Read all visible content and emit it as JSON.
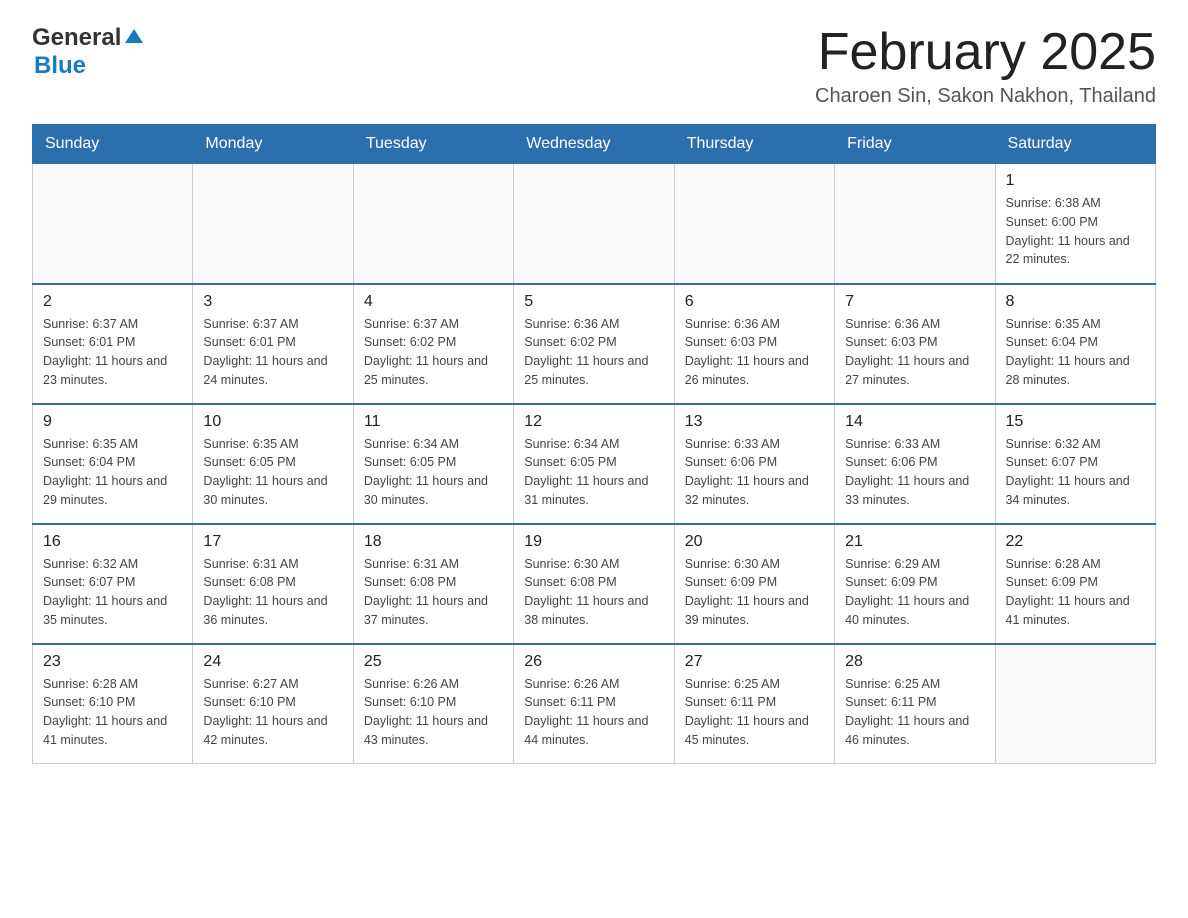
{
  "header": {
    "logo_text_general": "General",
    "logo_text_blue": "Blue",
    "title": "February 2025",
    "subtitle": "Charoen Sin, Sakon Nakhon, Thailand"
  },
  "days_of_week": [
    "Sunday",
    "Monday",
    "Tuesday",
    "Wednesday",
    "Thursday",
    "Friday",
    "Saturday"
  ],
  "weeks": [
    {
      "days": [
        {
          "number": "",
          "info": ""
        },
        {
          "number": "",
          "info": ""
        },
        {
          "number": "",
          "info": ""
        },
        {
          "number": "",
          "info": ""
        },
        {
          "number": "",
          "info": ""
        },
        {
          "number": "",
          "info": ""
        },
        {
          "number": "1",
          "info": "Sunrise: 6:38 AM\nSunset: 6:00 PM\nDaylight: 11 hours and 22 minutes."
        }
      ]
    },
    {
      "days": [
        {
          "number": "2",
          "info": "Sunrise: 6:37 AM\nSunset: 6:01 PM\nDaylight: 11 hours and 23 minutes."
        },
        {
          "number": "3",
          "info": "Sunrise: 6:37 AM\nSunset: 6:01 PM\nDaylight: 11 hours and 24 minutes."
        },
        {
          "number": "4",
          "info": "Sunrise: 6:37 AM\nSunset: 6:02 PM\nDaylight: 11 hours and 25 minutes."
        },
        {
          "number": "5",
          "info": "Sunrise: 6:36 AM\nSunset: 6:02 PM\nDaylight: 11 hours and 25 minutes."
        },
        {
          "number": "6",
          "info": "Sunrise: 6:36 AM\nSunset: 6:03 PM\nDaylight: 11 hours and 26 minutes."
        },
        {
          "number": "7",
          "info": "Sunrise: 6:36 AM\nSunset: 6:03 PM\nDaylight: 11 hours and 27 minutes."
        },
        {
          "number": "8",
          "info": "Sunrise: 6:35 AM\nSunset: 6:04 PM\nDaylight: 11 hours and 28 minutes."
        }
      ]
    },
    {
      "days": [
        {
          "number": "9",
          "info": "Sunrise: 6:35 AM\nSunset: 6:04 PM\nDaylight: 11 hours and 29 minutes."
        },
        {
          "number": "10",
          "info": "Sunrise: 6:35 AM\nSunset: 6:05 PM\nDaylight: 11 hours and 30 minutes."
        },
        {
          "number": "11",
          "info": "Sunrise: 6:34 AM\nSunset: 6:05 PM\nDaylight: 11 hours and 30 minutes."
        },
        {
          "number": "12",
          "info": "Sunrise: 6:34 AM\nSunset: 6:05 PM\nDaylight: 11 hours and 31 minutes."
        },
        {
          "number": "13",
          "info": "Sunrise: 6:33 AM\nSunset: 6:06 PM\nDaylight: 11 hours and 32 minutes."
        },
        {
          "number": "14",
          "info": "Sunrise: 6:33 AM\nSunset: 6:06 PM\nDaylight: 11 hours and 33 minutes."
        },
        {
          "number": "15",
          "info": "Sunrise: 6:32 AM\nSunset: 6:07 PM\nDaylight: 11 hours and 34 minutes."
        }
      ]
    },
    {
      "days": [
        {
          "number": "16",
          "info": "Sunrise: 6:32 AM\nSunset: 6:07 PM\nDaylight: 11 hours and 35 minutes."
        },
        {
          "number": "17",
          "info": "Sunrise: 6:31 AM\nSunset: 6:08 PM\nDaylight: 11 hours and 36 minutes."
        },
        {
          "number": "18",
          "info": "Sunrise: 6:31 AM\nSunset: 6:08 PM\nDaylight: 11 hours and 37 minutes."
        },
        {
          "number": "19",
          "info": "Sunrise: 6:30 AM\nSunset: 6:08 PM\nDaylight: 11 hours and 38 minutes."
        },
        {
          "number": "20",
          "info": "Sunrise: 6:30 AM\nSunset: 6:09 PM\nDaylight: 11 hours and 39 minutes."
        },
        {
          "number": "21",
          "info": "Sunrise: 6:29 AM\nSunset: 6:09 PM\nDaylight: 11 hours and 40 minutes."
        },
        {
          "number": "22",
          "info": "Sunrise: 6:28 AM\nSunset: 6:09 PM\nDaylight: 11 hours and 41 minutes."
        }
      ]
    },
    {
      "days": [
        {
          "number": "23",
          "info": "Sunrise: 6:28 AM\nSunset: 6:10 PM\nDaylight: 11 hours and 41 minutes."
        },
        {
          "number": "24",
          "info": "Sunrise: 6:27 AM\nSunset: 6:10 PM\nDaylight: 11 hours and 42 minutes."
        },
        {
          "number": "25",
          "info": "Sunrise: 6:26 AM\nSunset: 6:10 PM\nDaylight: 11 hours and 43 minutes."
        },
        {
          "number": "26",
          "info": "Sunrise: 6:26 AM\nSunset: 6:11 PM\nDaylight: 11 hours and 44 minutes."
        },
        {
          "number": "27",
          "info": "Sunrise: 6:25 AM\nSunset: 6:11 PM\nDaylight: 11 hours and 45 minutes."
        },
        {
          "number": "28",
          "info": "Sunrise: 6:25 AM\nSunset: 6:11 PM\nDaylight: 11 hours and 46 minutes."
        },
        {
          "number": "",
          "info": ""
        }
      ]
    }
  ]
}
